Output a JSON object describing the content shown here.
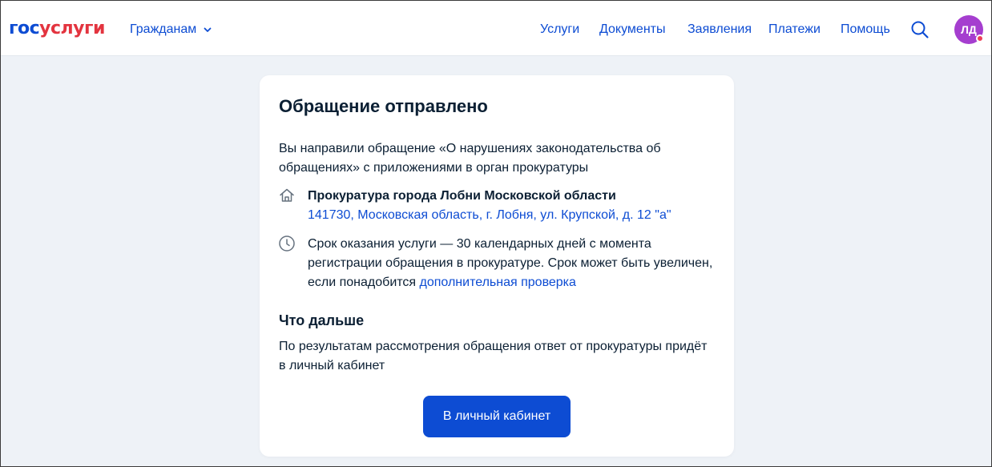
{
  "header": {
    "logo_part1": "гос",
    "logo_part2": "услуги",
    "audience_label": "Гражданам",
    "nav": [
      "Услуги",
      "Документы",
      "Заявления",
      "Платежи",
      "Помощь"
    ],
    "avatar_initials": "ЛД",
    "icons": {
      "audience": "chevron-down-icon",
      "search": "search-icon",
      "avatar_badge": "notification-dot-icon"
    }
  },
  "card": {
    "title": "Обращение отправлено",
    "intro": "Вы направили обращение «О нарушениях законодательства об обращениях» с приложениями в орган прокуратуры",
    "office": {
      "icon": "home-icon",
      "name": "Прокуратура города Лобни Московской области",
      "address": "141730, Московская область, г. Лобня, ул. Крупской, д. 12 \"а\""
    },
    "term": {
      "icon": "clock-icon",
      "text": "Срок оказания услуги — 30 календарных дней с момента регистрации обращения в прокуратуре. Срок может быть увеличен, если понадобится ",
      "link": "дополнительная проверка"
    },
    "next_title": "Что дальше",
    "next_text": "По результатам рассмотрения обращения ответ от прокуратуры придёт в личный кабинет",
    "button_label": "В личный кабинет"
  },
  "colors": {
    "brand_blue": "#0d4cd3",
    "brand_red": "#e3343f",
    "background": "#eef2f7",
    "avatar": "#a53ecf",
    "badge": "#ee3f58"
  }
}
